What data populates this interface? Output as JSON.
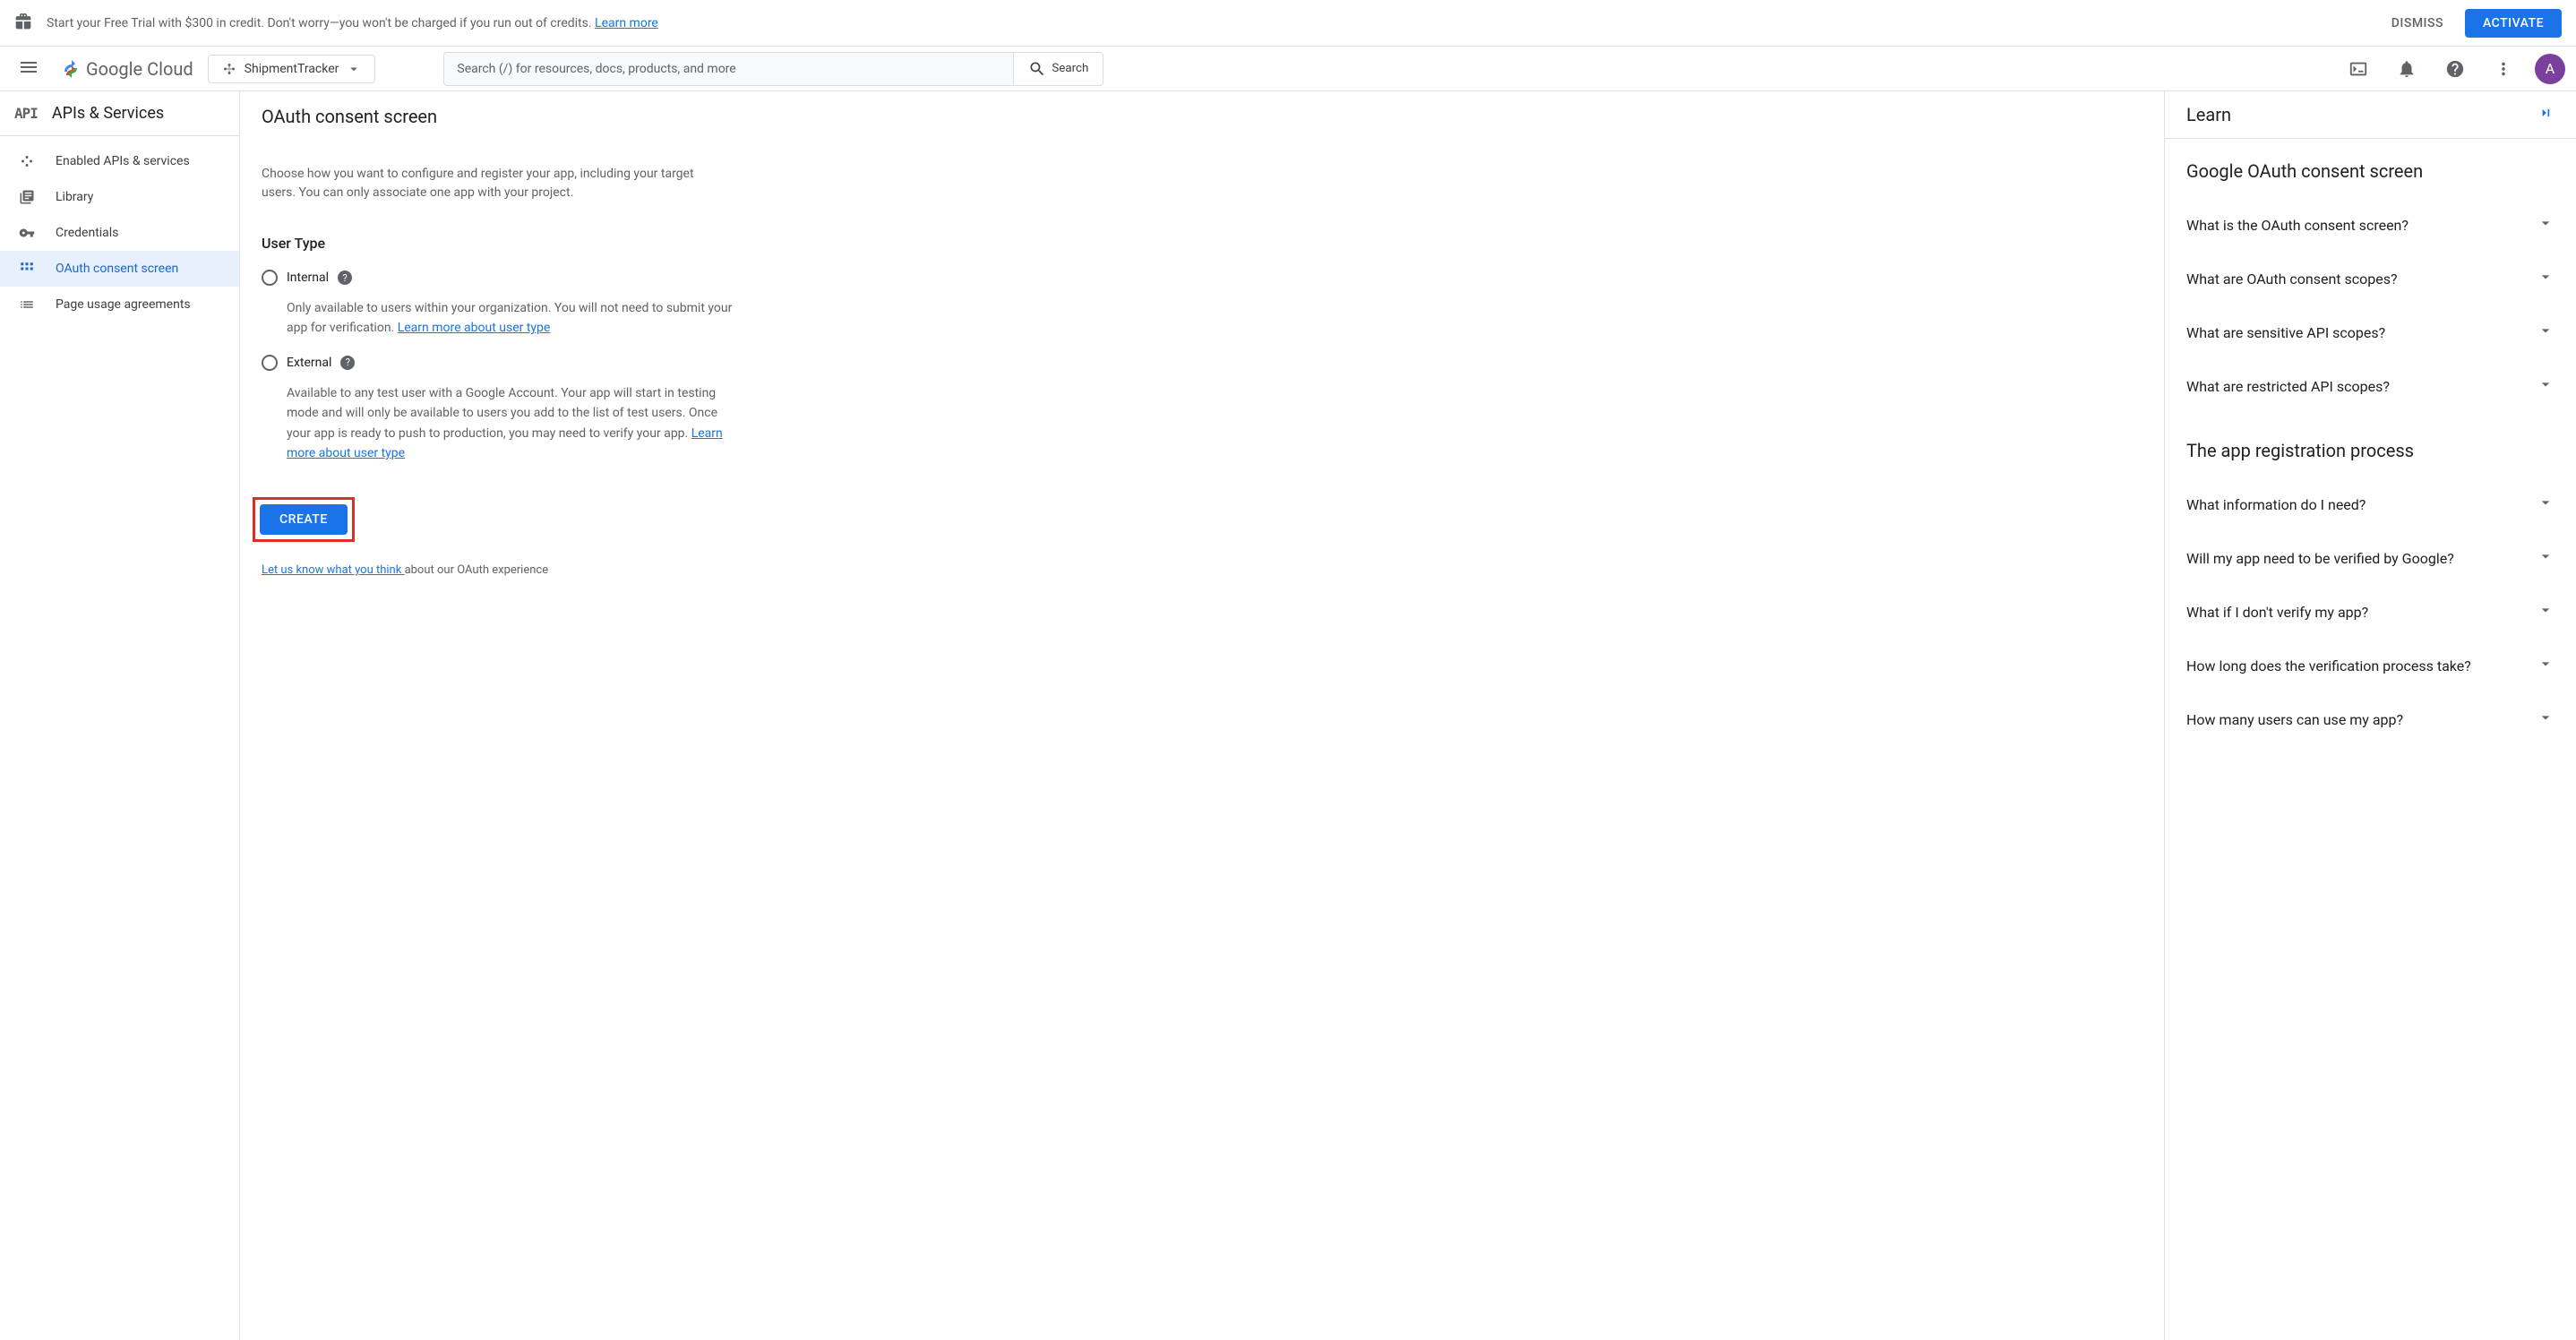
{
  "trialBanner": {
    "text": "Start your Free Trial with $300 in credit. Don't worry—you won't be charged if you run out of credits. ",
    "learnMore": "Learn more",
    "dismiss": "DISMISS",
    "activate": "ACTIVATE"
  },
  "topBar": {
    "logoText": "Google Cloud",
    "projectName": "ShipmentTracker",
    "searchPlaceholder": "Search (/) for resources, docs, products, and more",
    "searchButton": "Search",
    "avatarLetter": "A"
  },
  "sidebar": {
    "title": "APIs & Services",
    "items": [
      {
        "label": "Enabled APIs & services"
      },
      {
        "label": "Library"
      },
      {
        "label": "Credentials"
      },
      {
        "label": "OAuth consent screen"
      },
      {
        "label": "Page usage agreements"
      }
    ]
  },
  "content": {
    "title": "OAuth consent screen",
    "description": "Choose how you want to configure and register your app, including your target users. You can only associate one app with your project.",
    "userTypeTitle": "User Type",
    "internal": {
      "label": "Internal",
      "description": "Only available to users within your organization. You will not need to submit your app for verification. ",
      "learnMore": "Learn more about user type"
    },
    "external": {
      "label": "External",
      "description": "Available to any test user with a Google Account. Your app will start in testing mode and will only be available to users you add to the list of test users. Once your app is ready to push to production, you may need to verify your app. ",
      "learnMore": "Learn more about user type"
    },
    "createButton": "CREATE",
    "feedback": {
      "link": "Let us know what you think ",
      "text": "about our OAuth experience"
    }
  },
  "learn": {
    "title": "Learn",
    "section1": {
      "title": "Google OAuth consent screen",
      "items": [
        "What is the OAuth consent screen?",
        "What are OAuth consent scopes?",
        "What are sensitive API scopes?",
        "What are restricted API scopes?"
      ]
    },
    "section2": {
      "title": "The app registration process",
      "items": [
        "What information do I need?",
        "Will my app need to be verified by Google?",
        "What if I don't verify my app?",
        "How long does the verification process take?",
        "How many users can use my app?"
      ]
    }
  }
}
